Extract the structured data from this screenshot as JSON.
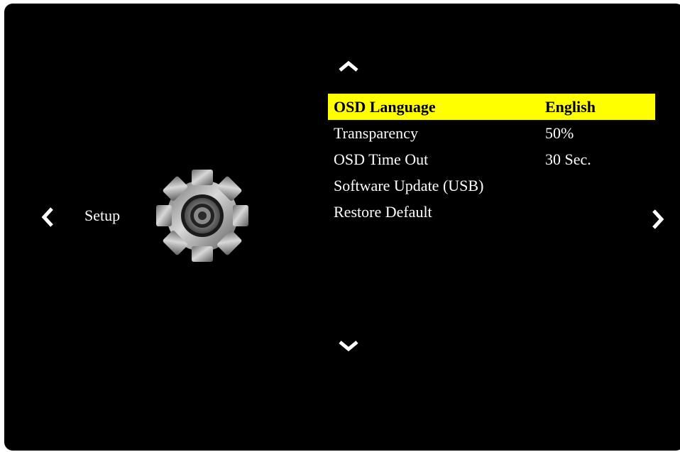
{
  "osd": {
    "category": "Setup",
    "category_icon": "gear-icon",
    "selected_color": "#ffff00",
    "nav_icons": [
      "chevron-left-icon",
      "chevron-right-icon",
      "chevron-up-icon",
      "chevron-down-icon"
    ],
    "menu": [
      {
        "label": "OSD Language",
        "value": "English",
        "selected": true
      },
      {
        "label": "Transparency",
        "value": "50%",
        "selected": false
      },
      {
        "label": "OSD Time Out",
        "value": "30 Sec.",
        "selected": false
      },
      {
        "label": "Software Update (USB)",
        "value": "",
        "selected": false
      },
      {
        "label": "Restore Default",
        "value": "",
        "selected": false
      }
    ]
  }
}
